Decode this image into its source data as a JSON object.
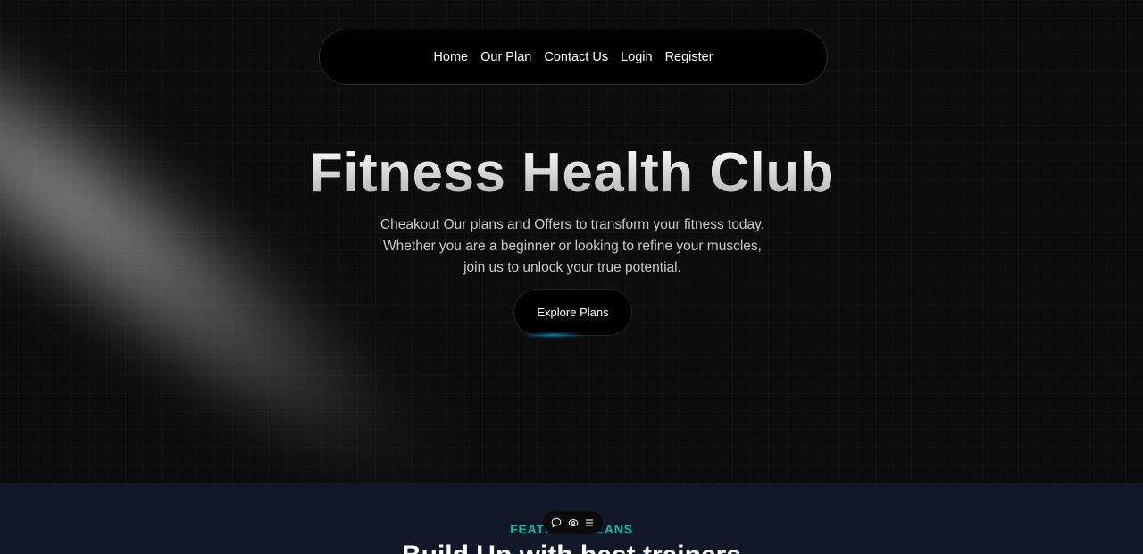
{
  "nav": {
    "links": [
      {
        "label": "Home"
      },
      {
        "label": "Our Plan"
      },
      {
        "label": "Contact Us"
      },
      {
        "label": "Login"
      },
      {
        "label": "Register"
      }
    ]
  },
  "hero": {
    "title": "Fitness Health Club",
    "subtitle": "Cheakout Our plans and Offers to transform your fitness today. Whether you are a beginner or looking to refine your muscles, join us to unlock your true potential.",
    "cta_label": "Explore Plans"
  },
  "featured": {
    "eyebrow": "FEATURED PLANS",
    "heading": "Build Up with best trainers"
  },
  "toolbar": {
    "icons": [
      "comment-icon",
      "eye-icon",
      "menu-icon"
    ]
  },
  "colors": {
    "hero_background": "#0c0c0d",
    "featured_background": "#111827",
    "accent_teal": "#14b8a6",
    "cta_glow": "#0ea5e9"
  }
}
